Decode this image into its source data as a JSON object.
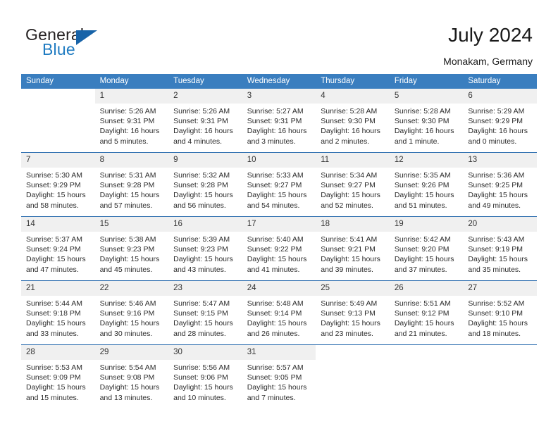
{
  "brand": {
    "name_part1": "General",
    "name_part2": "Blue",
    "triangle_color": "#1763a8",
    "blue_color": "#1f7bc1"
  },
  "header": {
    "title": "July 2024",
    "subtitle": "Monakam, Germany",
    "header_bg": "#3a7ebf",
    "row_divider": "#2f6fb0",
    "daynum_bg": "#f0f0f0"
  },
  "weekdays": [
    "Sunday",
    "Monday",
    "Tuesday",
    "Wednesday",
    "Thursday",
    "Friday",
    "Saturday"
  ],
  "weeks": [
    [
      {
        "day": "",
        "sunrise": "",
        "sunset": "",
        "daylight1": "",
        "daylight2": ""
      },
      {
        "day": "1",
        "sunrise": "Sunrise: 5:26 AM",
        "sunset": "Sunset: 9:31 PM",
        "daylight1": "Daylight: 16 hours",
        "daylight2": "and 5 minutes."
      },
      {
        "day": "2",
        "sunrise": "Sunrise: 5:26 AM",
        "sunset": "Sunset: 9:31 PM",
        "daylight1": "Daylight: 16 hours",
        "daylight2": "and 4 minutes."
      },
      {
        "day": "3",
        "sunrise": "Sunrise: 5:27 AM",
        "sunset": "Sunset: 9:31 PM",
        "daylight1": "Daylight: 16 hours",
        "daylight2": "and 3 minutes."
      },
      {
        "day": "4",
        "sunrise": "Sunrise: 5:28 AM",
        "sunset": "Sunset: 9:30 PM",
        "daylight1": "Daylight: 16 hours",
        "daylight2": "and 2 minutes."
      },
      {
        "day": "5",
        "sunrise": "Sunrise: 5:28 AM",
        "sunset": "Sunset: 9:30 PM",
        "daylight1": "Daylight: 16 hours",
        "daylight2": "and 1 minute."
      },
      {
        "day": "6",
        "sunrise": "Sunrise: 5:29 AM",
        "sunset": "Sunset: 9:29 PM",
        "daylight1": "Daylight: 16 hours",
        "daylight2": "and 0 minutes."
      }
    ],
    [
      {
        "day": "7",
        "sunrise": "Sunrise: 5:30 AM",
        "sunset": "Sunset: 9:29 PM",
        "daylight1": "Daylight: 15 hours",
        "daylight2": "and 58 minutes."
      },
      {
        "day": "8",
        "sunrise": "Sunrise: 5:31 AM",
        "sunset": "Sunset: 9:28 PM",
        "daylight1": "Daylight: 15 hours",
        "daylight2": "and 57 minutes."
      },
      {
        "day": "9",
        "sunrise": "Sunrise: 5:32 AM",
        "sunset": "Sunset: 9:28 PM",
        "daylight1": "Daylight: 15 hours",
        "daylight2": "and 56 minutes."
      },
      {
        "day": "10",
        "sunrise": "Sunrise: 5:33 AM",
        "sunset": "Sunset: 9:27 PM",
        "daylight1": "Daylight: 15 hours",
        "daylight2": "and 54 minutes."
      },
      {
        "day": "11",
        "sunrise": "Sunrise: 5:34 AM",
        "sunset": "Sunset: 9:27 PM",
        "daylight1": "Daylight: 15 hours",
        "daylight2": "and 52 minutes."
      },
      {
        "day": "12",
        "sunrise": "Sunrise: 5:35 AM",
        "sunset": "Sunset: 9:26 PM",
        "daylight1": "Daylight: 15 hours",
        "daylight2": "and 51 minutes."
      },
      {
        "day": "13",
        "sunrise": "Sunrise: 5:36 AM",
        "sunset": "Sunset: 9:25 PM",
        "daylight1": "Daylight: 15 hours",
        "daylight2": "and 49 minutes."
      }
    ],
    [
      {
        "day": "14",
        "sunrise": "Sunrise: 5:37 AM",
        "sunset": "Sunset: 9:24 PM",
        "daylight1": "Daylight: 15 hours",
        "daylight2": "and 47 minutes."
      },
      {
        "day": "15",
        "sunrise": "Sunrise: 5:38 AM",
        "sunset": "Sunset: 9:23 PM",
        "daylight1": "Daylight: 15 hours",
        "daylight2": "and 45 minutes."
      },
      {
        "day": "16",
        "sunrise": "Sunrise: 5:39 AM",
        "sunset": "Sunset: 9:23 PM",
        "daylight1": "Daylight: 15 hours",
        "daylight2": "and 43 minutes."
      },
      {
        "day": "17",
        "sunrise": "Sunrise: 5:40 AM",
        "sunset": "Sunset: 9:22 PM",
        "daylight1": "Daylight: 15 hours",
        "daylight2": "and 41 minutes."
      },
      {
        "day": "18",
        "sunrise": "Sunrise: 5:41 AM",
        "sunset": "Sunset: 9:21 PM",
        "daylight1": "Daylight: 15 hours",
        "daylight2": "and 39 minutes."
      },
      {
        "day": "19",
        "sunrise": "Sunrise: 5:42 AM",
        "sunset": "Sunset: 9:20 PM",
        "daylight1": "Daylight: 15 hours",
        "daylight2": "and 37 minutes."
      },
      {
        "day": "20",
        "sunrise": "Sunrise: 5:43 AM",
        "sunset": "Sunset: 9:19 PM",
        "daylight1": "Daylight: 15 hours",
        "daylight2": "and 35 minutes."
      }
    ],
    [
      {
        "day": "21",
        "sunrise": "Sunrise: 5:44 AM",
        "sunset": "Sunset: 9:18 PM",
        "daylight1": "Daylight: 15 hours",
        "daylight2": "and 33 minutes."
      },
      {
        "day": "22",
        "sunrise": "Sunrise: 5:46 AM",
        "sunset": "Sunset: 9:16 PM",
        "daylight1": "Daylight: 15 hours",
        "daylight2": "and 30 minutes."
      },
      {
        "day": "23",
        "sunrise": "Sunrise: 5:47 AM",
        "sunset": "Sunset: 9:15 PM",
        "daylight1": "Daylight: 15 hours",
        "daylight2": "and 28 minutes."
      },
      {
        "day": "24",
        "sunrise": "Sunrise: 5:48 AM",
        "sunset": "Sunset: 9:14 PM",
        "daylight1": "Daylight: 15 hours",
        "daylight2": "and 26 minutes."
      },
      {
        "day": "25",
        "sunrise": "Sunrise: 5:49 AM",
        "sunset": "Sunset: 9:13 PM",
        "daylight1": "Daylight: 15 hours",
        "daylight2": "and 23 minutes."
      },
      {
        "day": "26",
        "sunrise": "Sunrise: 5:51 AM",
        "sunset": "Sunset: 9:12 PM",
        "daylight1": "Daylight: 15 hours",
        "daylight2": "and 21 minutes."
      },
      {
        "day": "27",
        "sunrise": "Sunrise: 5:52 AM",
        "sunset": "Sunset: 9:10 PM",
        "daylight1": "Daylight: 15 hours",
        "daylight2": "and 18 minutes."
      }
    ],
    [
      {
        "day": "28",
        "sunrise": "Sunrise: 5:53 AM",
        "sunset": "Sunset: 9:09 PM",
        "daylight1": "Daylight: 15 hours",
        "daylight2": "and 15 minutes."
      },
      {
        "day": "29",
        "sunrise": "Sunrise: 5:54 AM",
        "sunset": "Sunset: 9:08 PM",
        "daylight1": "Daylight: 15 hours",
        "daylight2": "and 13 minutes."
      },
      {
        "day": "30",
        "sunrise": "Sunrise: 5:56 AM",
        "sunset": "Sunset: 9:06 PM",
        "daylight1": "Daylight: 15 hours",
        "daylight2": "and 10 minutes."
      },
      {
        "day": "31",
        "sunrise": "Sunrise: 5:57 AM",
        "sunset": "Sunset: 9:05 PM",
        "daylight1": "Daylight: 15 hours",
        "daylight2": "and 7 minutes."
      },
      {
        "day": "",
        "sunrise": "",
        "sunset": "",
        "daylight1": "",
        "daylight2": ""
      },
      {
        "day": "",
        "sunrise": "",
        "sunset": "",
        "daylight1": "",
        "daylight2": ""
      },
      {
        "day": "",
        "sunrise": "",
        "sunset": "",
        "daylight1": "",
        "daylight2": ""
      }
    ]
  ]
}
